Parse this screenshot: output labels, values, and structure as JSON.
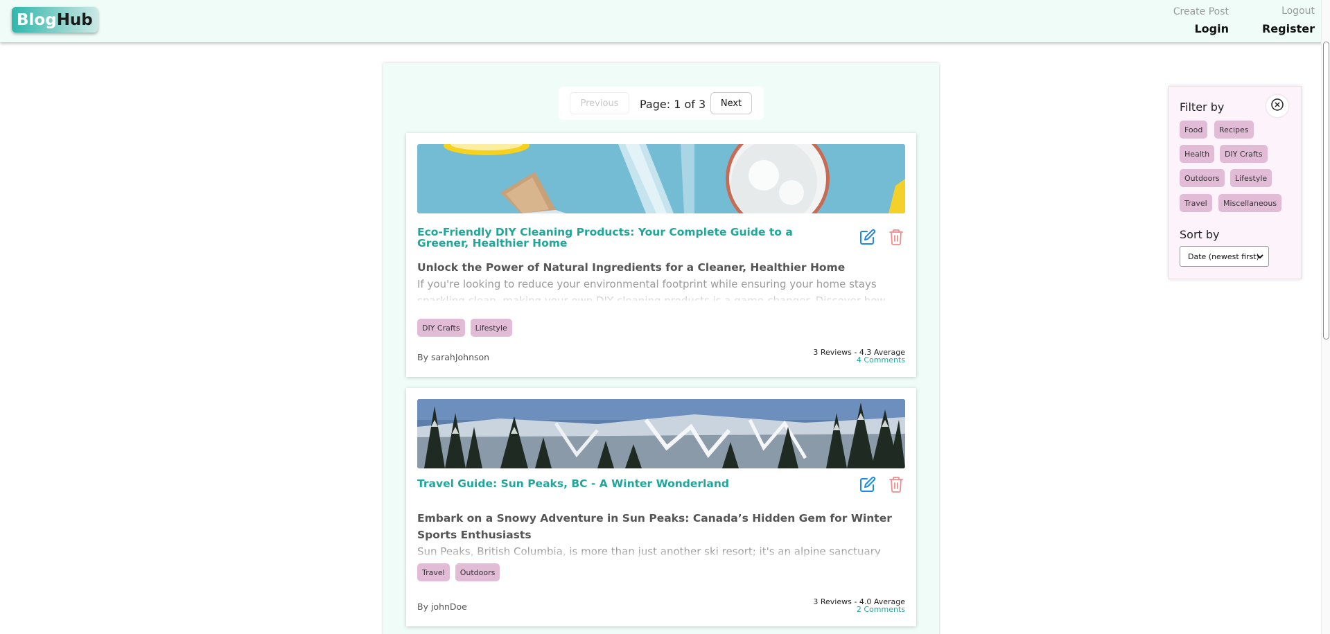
{
  "header": {
    "logo_part1": "Blog",
    "logo_part2": "Hub",
    "create_post": "Create Post",
    "logout": "Logout",
    "login": "Login",
    "register": "Register"
  },
  "pagination": {
    "previous": "Previous",
    "page_info": "Page: 1 of 3",
    "next": "Next"
  },
  "posts": [
    {
      "title": "Eco-Friendly DIY Cleaning Products: Your Complete Guide to a Greener, Healthier Home",
      "subtitle": "Unlock the Power of Natural Ingredients for a Cleaner, Healthier Home",
      "excerpt": "If you're looking to reduce your environmental footprint while ensuring your home stays sparkling clean, making your own DIY cleaning products is a game-changer. Discover how simple",
      "tags": [
        "DIY Crafts",
        "Lifestyle"
      ],
      "author": "By sarahJohnson",
      "reviews": "3 Reviews - 4.3 Average",
      "comments": "4 Comments"
    },
    {
      "title": "Travel Guide: Sun Peaks, BC - A Winter Wonderland",
      "subtitle": "Embark on a Snowy Adventure in Sun Peaks: Canada’s Hidden Gem for Winter Sports Enthusiasts",
      "excerpt": "Sun Peaks, British Columbia, is more than just another ski resort; it's an alpine sanctuary where",
      "tags": [
        "Travel",
        "Outdoors"
      ],
      "author": "By johnDoe",
      "reviews": "3 Reviews - 4.0 Average",
      "comments": "2 Comments"
    }
  ],
  "filter": {
    "title": "Filter by",
    "categories": [
      "Food",
      "Recipes",
      "Health",
      "DIY Crafts",
      "Outdoors",
      "Lifestyle",
      "Travel",
      "Miscellaneous"
    ],
    "sort_title": "Sort by",
    "sort_selected": "Date (newest first)"
  },
  "colors": {
    "accent": "#1fa79b",
    "tag": "#e2bcd6",
    "header_bg": "#effcf8",
    "filter_bg": "#fdf3fa",
    "edit_icon": "#1e88e5",
    "delete_icon": "#f28b8b"
  }
}
